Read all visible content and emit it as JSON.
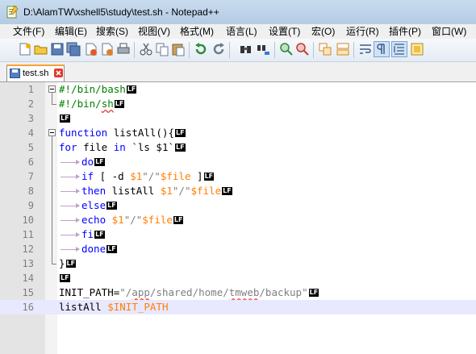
{
  "window": {
    "title": "D:\\AlamTW\\xshell5\\study\\test.sh - Notepad++"
  },
  "menu": [
    "文件(F)",
    "编辑(E)",
    "搜索(S)",
    "视图(V)",
    "格式(M)",
    "语言(L)",
    "设置(T)",
    "宏(O)",
    "运行(R)",
    "插件(P)",
    "窗口(W)"
  ],
  "toolbar_icons": [
    "new-file-icon",
    "open-file-icon",
    "save-icon",
    "save-all-icon",
    "close-icon",
    "close-all-icon",
    "print-icon",
    "cut-icon",
    "copy-icon",
    "paste-icon",
    "undo-icon",
    "redo-icon",
    "find-icon",
    "replace-icon",
    "zoom-in-icon",
    "zoom-out-icon",
    "sync-vertical-icon",
    "sync-horizontal-icon",
    "word-wrap-icon",
    "show-all-characters-icon",
    "indent-guide-icon",
    "document-map-icon"
  ],
  "tab": {
    "label": "test.sh"
  },
  "editor": {
    "eol_marker": "LF",
    "current_line": 16,
    "lines": [
      {
        "n": "1",
        "tokens": [
          {
            "t": "#!/bin/bash",
            "c": "comment"
          }
        ],
        "eol": true
      },
      {
        "n": "2",
        "tokens": [
          {
            "t": "#!/bin/",
            "c": "comment"
          },
          {
            "t": "sh",
            "c": "comment",
            "sq": true
          }
        ],
        "eol": true
      },
      {
        "n": "3",
        "tokens": [],
        "eol": true
      },
      {
        "n": "4",
        "tokens": [
          {
            "t": "function",
            "c": "kw"
          },
          {
            "t": " listAll(){",
            "c": "op"
          }
        ],
        "eol": true
      },
      {
        "n": "5",
        "tokens": [
          {
            "t": "for",
            "c": "kw"
          },
          {
            "t": " file ",
            "c": "op"
          },
          {
            "t": "in",
            "c": "kw"
          },
          {
            "t": " `ls $1`",
            "c": "op"
          }
        ],
        "eol": true
      },
      {
        "n": "6",
        "tab": true,
        "tokens": [
          {
            "t": "do",
            "c": "kw"
          }
        ],
        "eol": true
      },
      {
        "n": "7",
        "tab": true,
        "tokens": [
          {
            "t": "if",
            "c": "kw"
          },
          {
            "t": " [ -d ",
            "c": "op"
          },
          {
            "t": "$1",
            "c": "var"
          },
          {
            "t": "\"/\"",
            "c": "str"
          },
          {
            "t": "$file",
            "c": "var"
          },
          {
            "t": " ]",
            "c": "op"
          }
        ],
        "eol": true
      },
      {
        "n": "8",
        "tab": true,
        "tokens": [
          {
            "t": "then",
            "c": "kw"
          },
          {
            "t": " listAll ",
            "c": "op"
          },
          {
            "t": "$1",
            "c": "var"
          },
          {
            "t": "\"/\"",
            "c": "str"
          },
          {
            "t": "$file",
            "c": "var"
          }
        ],
        "eol": true
      },
      {
        "n": "9",
        "tab": true,
        "tokens": [
          {
            "t": "else",
            "c": "kw"
          }
        ],
        "eol": true
      },
      {
        "n": "10",
        "tab": true,
        "tokens": [
          {
            "t": "echo",
            "c": "kw"
          },
          {
            "t": " ",
            "c": "op"
          },
          {
            "t": "$1",
            "c": "var"
          },
          {
            "t": "\"/\"",
            "c": "str"
          },
          {
            "t": "$file",
            "c": "var"
          }
        ],
        "eol": true
      },
      {
        "n": "11",
        "tab": true,
        "tokens": [
          {
            "t": "fi",
            "c": "kw"
          }
        ],
        "eol": true
      },
      {
        "n": "12",
        "tab": true,
        "tokens": [
          {
            "t": "done",
            "c": "kw"
          }
        ],
        "eol": true
      },
      {
        "n": "13",
        "tokens": [
          {
            "t": "}",
            "c": "op"
          }
        ],
        "eol": true
      },
      {
        "n": "14",
        "tokens": [],
        "eol": true
      },
      {
        "n": "15",
        "tokens": [
          {
            "t": "INIT_PATH=",
            "c": "op"
          },
          {
            "t": "\"/",
            "c": "str"
          },
          {
            "t": "app",
            "c": "str",
            "sq": true
          },
          {
            "t": "/shared/home/",
            "c": "str"
          },
          {
            "t": "tmweb",
            "c": "str",
            "sq": true
          },
          {
            "t": "/backup\"",
            "c": "str"
          }
        ],
        "eol": true
      },
      {
        "n": "16",
        "tokens": [
          {
            "t": "listAll ",
            "c": "op"
          },
          {
            "t": "$INIT_PATH",
            "c": "var"
          }
        ],
        "eol": false
      }
    ]
  }
}
